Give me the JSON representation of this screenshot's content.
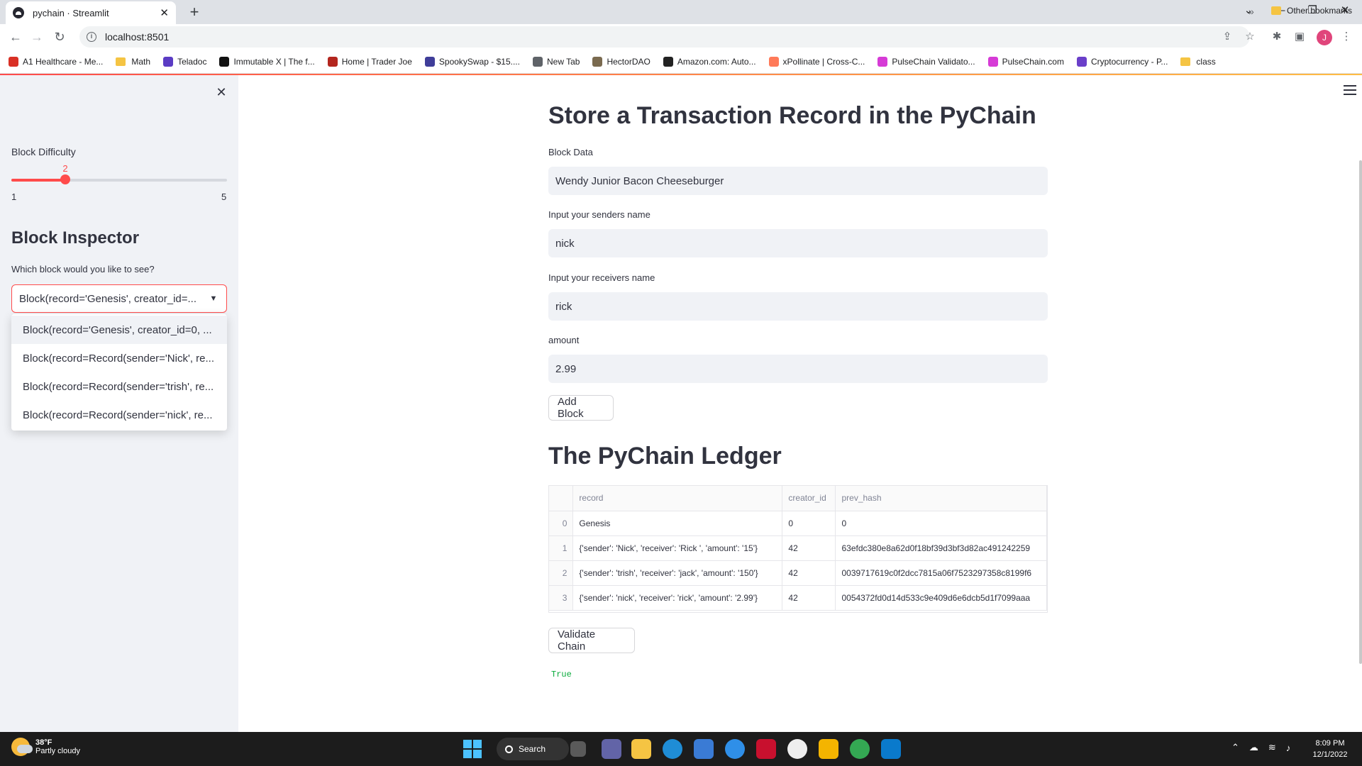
{
  "browser": {
    "tab_title": "pychain · Streamlit",
    "new_tab_symbol": "+",
    "url": "localhost:8501",
    "profile_initial": "J",
    "bookmarks": [
      {
        "label": "A1 Healthcare - Me...",
        "color": "#d93025"
      },
      {
        "label": "Math",
        "folder": true
      },
      {
        "label": "Teladoc",
        "color": "#5b3cc4"
      },
      {
        "label": "Immutable X | The f...",
        "color": "#111111"
      },
      {
        "label": "Home | Trader Joe",
        "color": "#b3261e"
      },
      {
        "label": "SpookySwap - $15....",
        "color": "#3f3d99"
      },
      {
        "label": "New Tab",
        "color": "#5f6368"
      },
      {
        "label": "HectorDAO",
        "color": "#7a6a4f"
      },
      {
        "label": "Amazon.com: Auto...",
        "color": "#222222"
      },
      {
        "label": "xPollinate | Cross-C...",
        "color": "#ff7a59"
      },
      {
        "label": "PulseChain Validato...",
        "color": "#d63bd6"
      },
      {
        "label": "PulseChain.com",
        "color": "#d63bd6"
      },
      {
        "label": "Cryptocurrency - P...",
        "color": "#6a3fc9"
      },
      {
        "label": "class",
        "folder": true
      }
    ],
    "bookmarks_more": "»",
    "other_bookmarks": "Other bookmarks"
  },
  "sidebar": {
    "close_symbol": "✕",
    "difficulty_label": "Block Difficulty",
    "difficulty_value": 2,
    "difficulty_min": 1,
    "difficulty_max": 5,
    "heading": "Block Inspector",
    "select_label": "Which block would you like to see?",
    "select_value": "Block(record='Genesis', creator_id=...",
    "select_caret": "▼",
    "options": [
      "Block(record='Genesis', creator_id=0, ...",
      "Block(record=Record(sender='Nick', re...",
      "Block(record=Record(sender='trish', re...",
      "Block(record=Record(sender='nick', re..."
    ]
  },
  "main": {
    "title": "Store a Transaction Record in the PyChain",
    "fields": [
      {
        "label": "Block Data",
        "value": "Wendy Junior Bacon Cheeseburger"
      },
      {
        "label": "Input your senders name",
        "value": "nick"
      },
      {
        "label": "Input your receivers name",
        "value": "rick"
      },
      {
        "label": "amount",
        "value": "2.99"
      }
    ],
    "add_block_label": "Add Block",
    "ledger_title": "The PyChain Ledger",
    "ledger": {
      "columns": [
        "",
        "record",
        "creator_id",
        "prev_hash"
      ],
      "rows": [
        [
          "0",
          "Genesis",
          "0",
          "0"
        ],
        [
          "1",
          "{'sender': 'Nick', 'receiver': 'Rick ', 'amount': '15'}",
          "42",
          "63efdc380e8a62d0f18bf39d3bf3d82ac491242259"
        ],
        [
          "2",
          "{'sender': 'trish', 'receiver': 'jack', 'amount': '150'}",
          "42",
          "0039717619c0f2dcc7815a06f7523297358c8199f6"
        ],
        [
          "3",
          "{'sender': 'nick', 'receiver': 'rick', 'amount': '2.99'}",
          "42",
          "0054372fd0d14d533c9e409d6e6dcb5d1f7099aaa"
        ]
      ]
    },
    "validate_label": "Validate Chain",
    "validate_result": "True"
  },
  "taskbar": {
    "temperature": "38°F",
    "condition": "Partly cloudy",
    "search_label": "Search",
    "time": "8:09 PM",
    "date": "12/1/2022"
  },
  "colors": {
    "accent": "#ff4b4b",
    "sidebar_bg": "#f0f2f6",
    "success": "#09ab3b"
  }
}
